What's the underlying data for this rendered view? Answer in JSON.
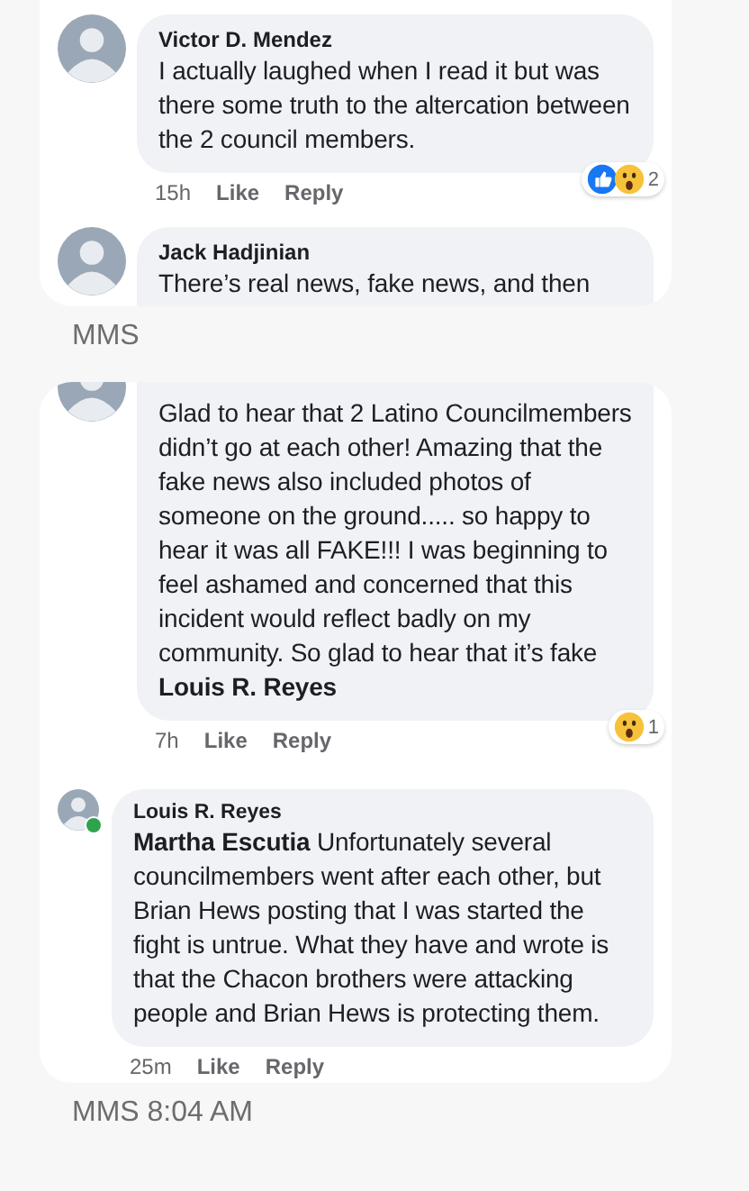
{
  "messages": [
    {
      "comments": [
        {
          "name": "Victor D. Mendez",
          "text": "I actually laughed when I read it but was there some truth to the altercation between the 2 council members.",
          "time": "15h",
          "like": "Like",
          "reply": "Reply",
          "online": false,
          "reactions": [
            {
              "kind": "like"
            },
            {
              "kind": "wow"
            }
          ],
          "reaction_count": "2"
        },
        {
          "name": "Jack Hadjinian",
          "text": "There’s real news, fake news, and then",
          "online": false
        }
      ],
      "label": "MMS"
    },
    {
      "comments": [
        {
          "text": "Glad to hear that 2 Latino Councilmembers didn’t go at each other!  Amazing that the fake news also included photos of someone on the ground..... so happy to hear it was all FAKE!!!  I was beginning to feel ashamed and concerned that this incident would reflect badly on my community.  So glad to hear that it’s fake **Louis R. Reyes**",
          "time": "7h",
          "like": "Like",
          "reply": "Reply",
          "online": false,
          "reactions": [
            {
              "kind": "wow"
            }
          ],
          "reaction_count": "1",
          "children": [
            {
              "name": "Louis R. Reyes",
              "text": "**Martha Escutia** Unfortunately several councilmembers went after each other, but Brian Hews posting that I was started the fight is untrue. What they have and wrote is that the Chacon brothers were attacking people and Brian Hews is protecting them.",
              "time": "25m",
              "like": "Like",
              "reply": "Reply",
              "online": true
            }
          ]
        }
      ],
      "label": "MMS 8:04 AM"
    }
  ]
}
